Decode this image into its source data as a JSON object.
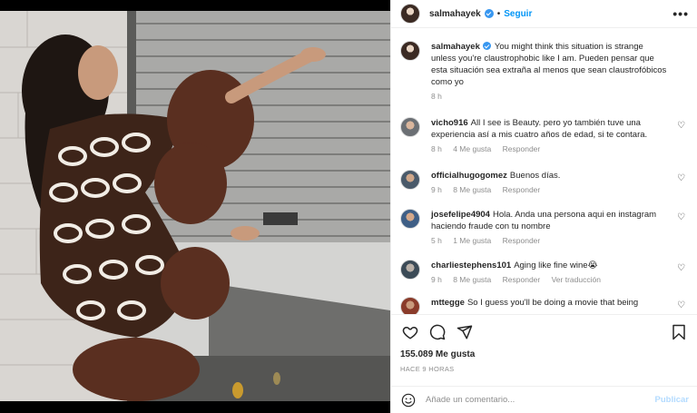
{
  "post": {
    "author": "salmahayek",
    "follow_label": "Seguir",
    "separator": "•",
    "more_label": "•••",
    "image_subject": "woman in patterned outfit with feather trim crouching by metal shutter"
  },
  "caption": {
    "username": "salmahayek",
    "text": "You might think this situation is strange unless you're claustrophobic like I am. Pueden pensar que esta situación sea extraña al menos que sean claustrofóbicos como yo",
    "time": "8 h"
  },
  "comments": [
    {
      "username": "vicho916",
      "text": "All I see is Beauty. pero yo también tuve una experiencia así a mis cuatro años de edad, si te contara.",
      "time": "8 h",
      "likes": "4 Me gusta",
      "reply": "Responder"
    },
    {
      "username": "officialhugogomez",
      "text": "Buenos días.",
      "time": "9 h",
      "likes": "8 Me gusta",
      "reply": "Responder"
    },
    {
      "username": "josefelipe4904",
      "text": "Hola. Anda una persona aqui en instagram haciendo fraude con tu nombre",
      "time": "5 h",
      "likes": "1 Me gusta",
      "reply": "Responder"
    },
    {
      "username": "charliestephens101",
      "text": "Aging like fine wine😭",
      "time": "9 h",
      "likes": "8 Me gusta",
      "reply": "Responder",
      "translation": "Ver traducción"
    },
    {
      "username": "mttegge",
      "text": "So I guess you'll be doing a movie that being"
    }
  ],
  "stats": {
    "likes": "155.089 Me gusta",
    "time_ago": "HACE 9 HORAS"
  },
  "composer": {
    "placeholder": "Añade un comentario...",
    "publish_label": "Publicar"
  },
  "colors": {
    "link_blue": "#0095f6",
    "publish_disabled": "#b3dbff",
    "verified_blue": "#3897f0",
    "muted_text": "#8e8e8e"
  },
  "icons": [
    "verified-badge-icon",
    "more-options-icon",
    "heart-icon",
    "comment-icon",
    "share-icon",
    "bookmark-icon",
    "emoji-icon"
  ]
}
